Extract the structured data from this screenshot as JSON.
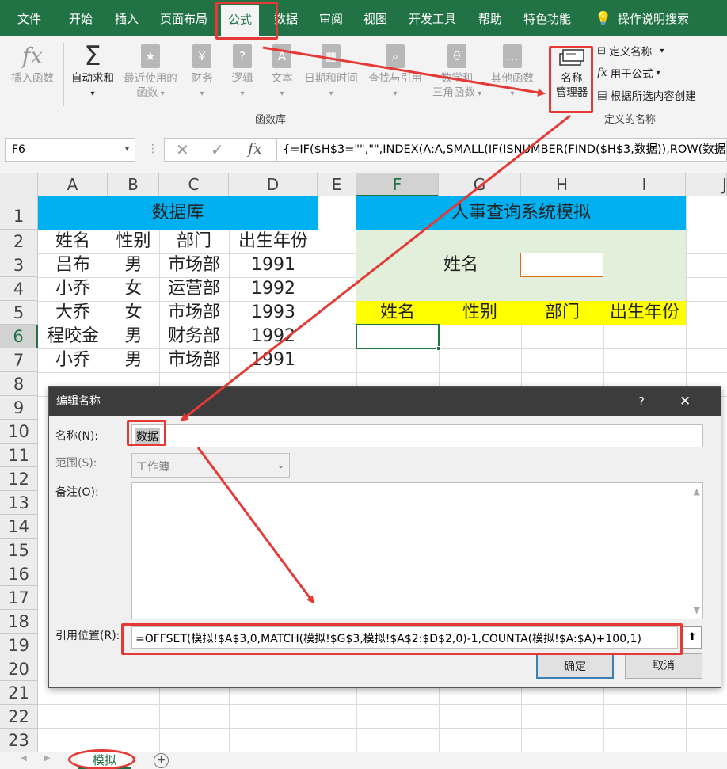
{
  "menu": [
    "文件",
    "开始",
    "插入",
    "页面布局",
    "公式",
    "数据",
    "审阅",
    "视图",
    "开发工具",
    "帮助",
    "特色功能"
  ],
  "menu_active": "公式",
  "search_label": "操作说明搜索",
  "ribbon": {
    "insert_function": "插入函数",
    "autosum": "自动求和",
    "recent_1": "最近使用的",
    "recent_2": "函数",
    "financial": "财务",
    "logical": "逻辑",
    "text": "文本",
    "datetime": "日期和时间",
    "lookup": "查找与引用",
    "math_1": "数学和",
    "math_2": "三角函数",
    "more": "其他函数",
    "function_library": "函数库",
    "name_manager_1": "名称",
    "name_manager_2": "管理器",
    "define_name": "定义名称",
    "use_in_formula": "用于公式",
    "create_from_selection": "根据所选内容创建",
    "defined_names": "定义的名称"
  },
  "namebox": "F6",
  "formula": "{=IF($H$3=\"\",\"\",INDEX(A:A,SMALL(IF(ISNUMBER(FIND($H$3,数据)),ROW(数据",
  "columns": [
    "A",
    "B",
    "C",
    "D",
    "E",
    "F",
    "G",
    "H",
    "I",
    "J"
  ],
  "rows": [
    "1",
    "2",
    "3",
    "4",
    "5",
    "6",
    "7",
    "8",
    "9",
    "10",
    "11",
    "12",
    "13",
    "14",
    "15",
    "16",
    "17",
    "18",
    "19",
    "20",
    "21",
    "22",
    "23"
  ],
  "database": {
    "title": "数据库",
    "headers": [
      "姓名",
      "性别",
      "部门",
      "出生年份"
    ],
    "rows": [
      [
        "吕布",
        "男",
        "市场部",
        "1991"
      ],
      [
        "小乔",
        "女",
        "运营部",
        "1992"
      ],
      [
        "大乔",
        "女",
        "市场部",
        "1993"
      ],
      [
        "程咬金",
        "男",
        "财务部",
        "1992"
      ],
      [
        "小乔",
        "男",
        "市场部",
        "1991"
      ]
    ]
  },
  "query": {
    "title": "人事查询系统模拟",
    "name_label": "姓名",
    "headers": [
      "姓名",
      "性别",
      "部门",
      "出生年份"
    ]
  },
  "dialog": {
    "title": "编辑名称",
    "help": "?",
    "close": "✕",
    "name_label": "名称(N):",
    "name_value": "数据",
    "scope_label": "范围(S):",
    "scope_value": "工作簿",
    "comment_label": "备注(O):",
    "ref_label": "引用位置(R):",
    "ref_value": "=OFFSET(模拟!$A$3,0,MATCH(模拟!$G$3,模拟!$A$2:$D$2,0)-1,COUNTA(模拟!$A:$A)+100,1)",
    "ok": "确定",
    "cancel": "取消"
  },
  "sheet_tab": "模拟",
  "colors": {
    "excel_green": "#217346",
    "db_header": "#00B0F0",
    "query_bg": "#E2EFDA",
    "yellow": "#FFFF00",
    "highlight": "#E53935"
  }
}
